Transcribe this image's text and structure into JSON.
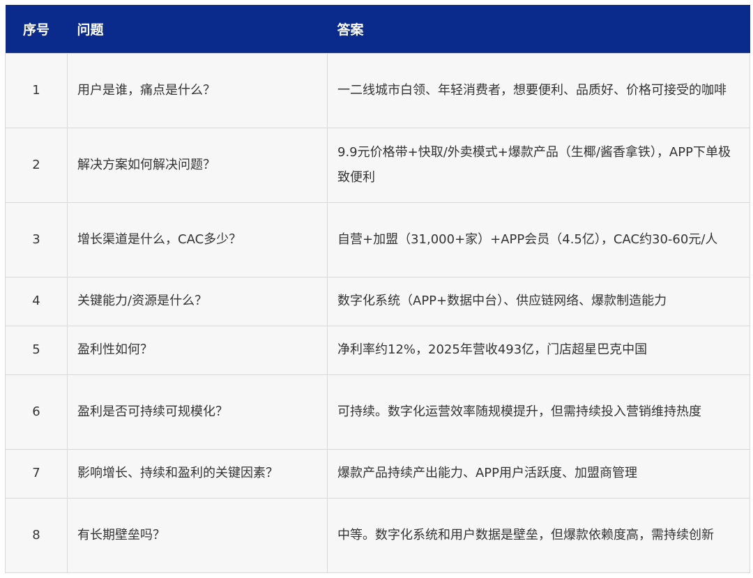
{
  "table": {
    "headers": {
      "num": "序号",
      "question": "问题",
      "answer": "答案"
    },
    "rows": [
      {
        "num": "1",
        "question": "用户是谁，痛点是什么？",
        "answer": "一二线城市白领、年轻消费者，想要便利、品质好、价格可接受的咖啡"
      },
      {
        "num": "2",
        "question": "解决方案如何解决问题？",
        "answer": "9.9元价格带+快取/外卖模式+爆款产品（生椰/酱香拿铁），APP下单极致便利"
      },
      {
        "num": "3",
        "question": "增长渠道是什么，CAC多少？",
        "answer": "自营+加盟（31,000+家）+APP会员（4.5亿），CAC约30-60元/人"
      },
      {
        "num": "4",
        "question": "关键能力/资源是什么？",
        "answer": "数字化系统（APP+数据中台）、供应链网络、爆款制造能力"
      },
      {
        "num": "5",
        "question": "盈利性如何？",
        "answer": "净利率约12%，2025年营收493亿，门店超星巴克中国"
      },
      {
        "num": "6",
        "question": "盈利是否可持续可规模化？",
        "answer": "可持续。数字化运营效率随规模提升，但需持续投入营销维持热度"
      },
      {
        "num": "7",
        "question": "影响增长、持续和盈利的关键因素？",
        "answer": "爆款产品持续产出能力、APP用户活跃度、加盟商管理"
      },
      {
        "num": "8",
        "question": "有长期壁垒吗？",
        "answer": "中等。数字化系统和用户数据是壁垒，但爆款依赖度高，需持续创新"
      }
    ]
  }
}
